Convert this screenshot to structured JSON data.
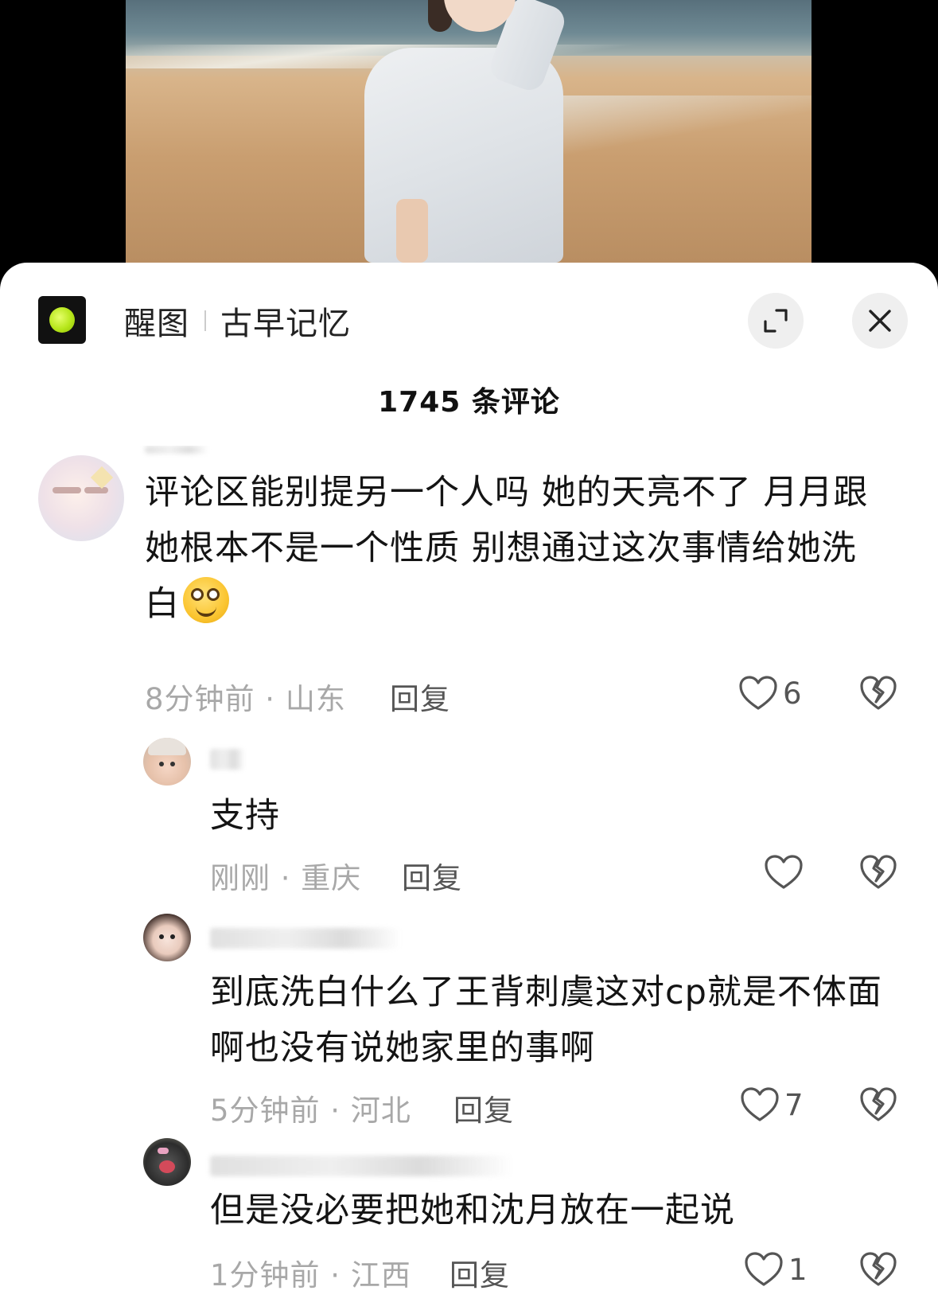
{
  "header": {
    "app_name": "醒图",
    "account_name": "古早记忆",
    "expand_icon": "expand-icon",
    "close_icon": "close-icon"
  },
  "comment_count": "1745 条评论",
  "comments": [
    {
      "text_lines": [
        "评论区能别提另一个人吗 她的天亮不了 月月跟",
        "她根本不是一个性质 别想通过这次事情给她洗",
        "白"
      ],
      "emoji": "smiling-face-emoji",
      "meta": "8分钟前 · 山东",
      "reply": "回复",
      "likes": "6"
    },
    {
      "text_lines": [
        "支持"
      ],
      "meta": "刚刚 · 重庆",
      "reply": "回复",
      "likes": ""
    },
    {
      "text_lines": [
        "到底洗白什么了王背刺虞这对cp就是不体面",
        "啊也没有说她家里的事啊"
      ],
      "meta": "5分钟前 · 河北",
      "reply": "回复",
      "likes": "7"
    },
    {
      "text_lines": [
        "但是没必要把她和沈月放在一起说"
      ],
      "meta": "1分钟前 · 江西",
      "reply": "回复",
      "likes": "1"
    }
  ],
  "colors": {
    "sheet_bg": "#ffffff",
    "meta_gray": "#a8a8a8",
    "text": "#141414",
    "logo_green": "#b6e61a"
  }
}
